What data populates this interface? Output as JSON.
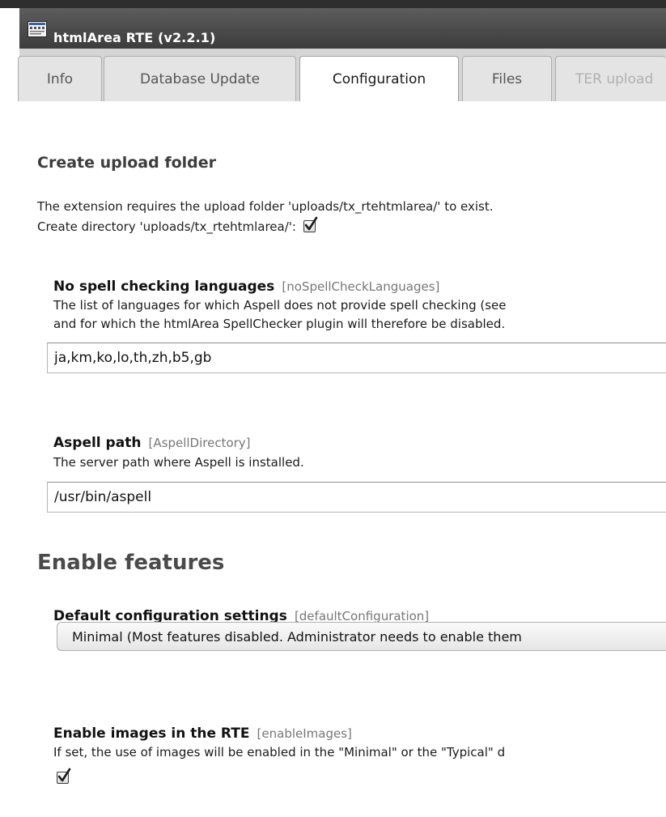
{
  "window": {
    "title": "htmlArea RTE (v2.2.1)",
    "icon": "rte-editor-icon"
  },
  "tabs": [
    {
      "label": "Info",
      "state": "normal"
    },
    {
      "label": "Database Update",
      "state": "normal"
    },
    {
      "label": "Configuration",
      "state": "active"
    },
    {
      "label": "Files",
      "state": "normal"
    },
    {
      "label": "TER upload",
      "state": "disabled"
    }
  ],
  "upload": {
    "heading": "Create upload folder",
    "line1": "The extension requires the upload folder 'uploads/tx_rtehtmlarea/' to exist.",
    "line2": "Create directory 'uploads/tx_rtehtmlarea/':",
    "checked": true
  },
  "spell": {
    "label": "No spell checking languages",
    "key": "[noSpellCheckLanguages]",
    "desc1": "The list of languages for which Aspell does not provide spell checking (see",
    "desc2": "and for which the htmlArea SpellChecker plugin will therefore be disabled.",
    "value": "ja,km,ko,lo,th,zh,b5,gb"
  },
  "aspell": {
    "label": "Aspell path",
    "key": "[AspellDirectory]",
    "desc": "The server path where Aspell is installed.",
    "value": "/usr/bin/aspell"
  },
  "features": {
    "heading": "Enable features"
  },
  "defaultConfig": {
    "label": "Default configuration settings",
    "key": "[defaultConfiguration]",
    "selected": "Minimal (Most features disabled. Administrator needs to enable them"
  },
  "images": {
    "label": "Enable images in the RTE",
    "key": "[enableImages]",
    "desc": "If set, the use of images will be enabled in the \"Minimal\" or the \"Typical\" d",
    "checked": true
  },
  "colors": {
    "titlebar": "#4a4a4a",
    "tabs_bg": "#d5d5d5",
    "heading": "#3d3d3d"
  }
}
